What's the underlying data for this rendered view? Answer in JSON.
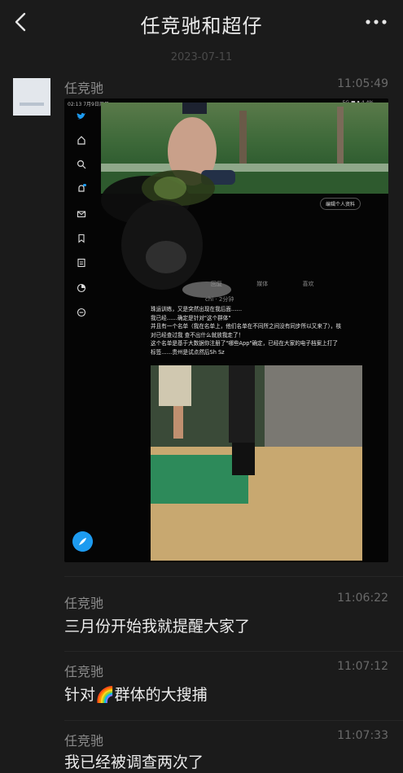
{
  "header": {
    "title": "任竞驰和超仔",
    "back_icon": "chevron-left-icon",
    "more_icon": "more-dots-icon"
  },
  "date_divider": "2023-07-11",
  "messages": [
    {
      "sender": "任竞驰",
      "time": "11:05:49",
      "type": "image"
    },
    {
      "sender": "任竞驰",
      "time": "11:06:22",
      "text": "三月份开始我就提醒大家了"
    },
    {
      "sender": "任竞驰",
      "time": "11:07:12",
      "text": "针对🌈群体的大搜捕"
    },
    {
      "sender": "任竞驰",
      "time": "11:07:33",
      "text": "我已经被调查两次了"
    }
  ],
  "screenshot": {
    "status_time": "02:13  7月9日周日",
    "status_right": "5G ■ ▮ 4.4%",
    "edit_profile": "编辑个人资料",
    "tabs": [
      "回复",
      "媒体",
      "喜欢"
    ],
    "handle": "chi · 2分钟",
    "tweet_lines": [
      "珠运训练，又是突然出现在我后面……",
      "我已经……确定是针对\"这个群体\"",
      "并且有一个名单（我在名单上，他们名单在不同所之间没有同步所以又来了），核对已经查过我 查不出什么就放我走了！",
      "这个名单是基于大数据你注册了\"哪些App\"确定，已经在大家的电子档案上打了标签……贵州是试点然后Sh Sz"
    ]
  },
  "colors": {
    "background": "#1b1b1b",
    "accent_blue": "#1d9bf0"
  }
}
